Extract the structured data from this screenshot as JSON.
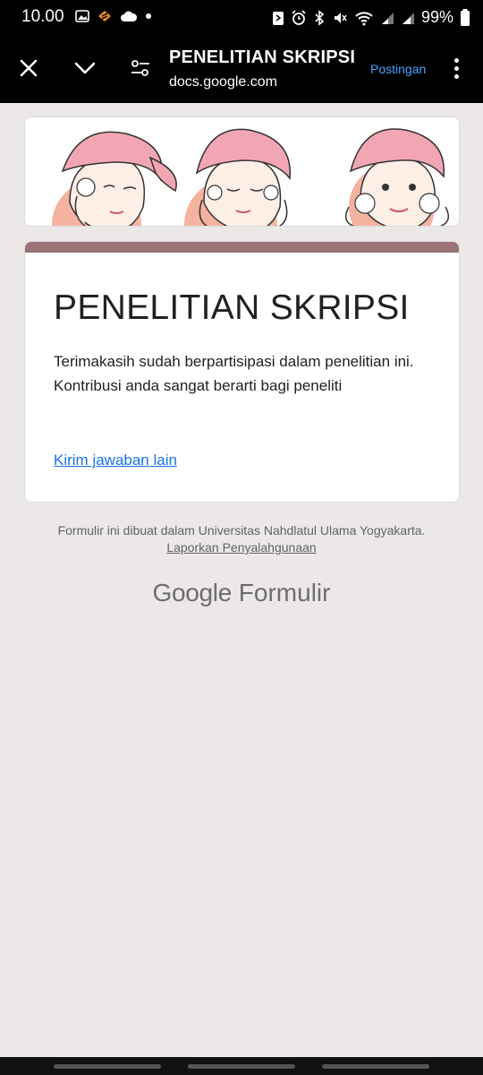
{
  "status_bar": {
    "time": "10.00",
    "battery": "99%",
    "icons": [
      "gallery-icon",
      "app-icon",
      "cloud-icon",
      "dot-icon",
      "nfc-icon",
      "alarm-icon",
      "bluetooth-icon",
      "mute-icon",
      "wifi-icon",
      "signal-icon",
      "signal-icon-2",
      "battery-icon"
    ]
  },
  "browser": {
    "title": "PENELITIAN SKRIPSI",
    "url": "docs.google.com",
    "post_label": "Postingan",
    "accent": "#4ba3ff"
  },
  "form": {
    "title": "PENELITIAN SKRIPSI",
    "message": "Terimakasih sudah berpartisipasi dalam penelitian ini. Kontribusi anda sangat berarti bagi peneliti",
    "another_response": "Kirim jawaban lain",
    "stripe_color": "#9b7275"
  },
  "footer": {
    "text": "Formulir ini dibuat dalam Universitas Nahdlatul Ulama Yogyakarta.",
    "report_link": "Laporkan Penyalahgunaan"
  },
  "brand": {
    "google": "Google",
    "product": "Formulir"
  }
}
